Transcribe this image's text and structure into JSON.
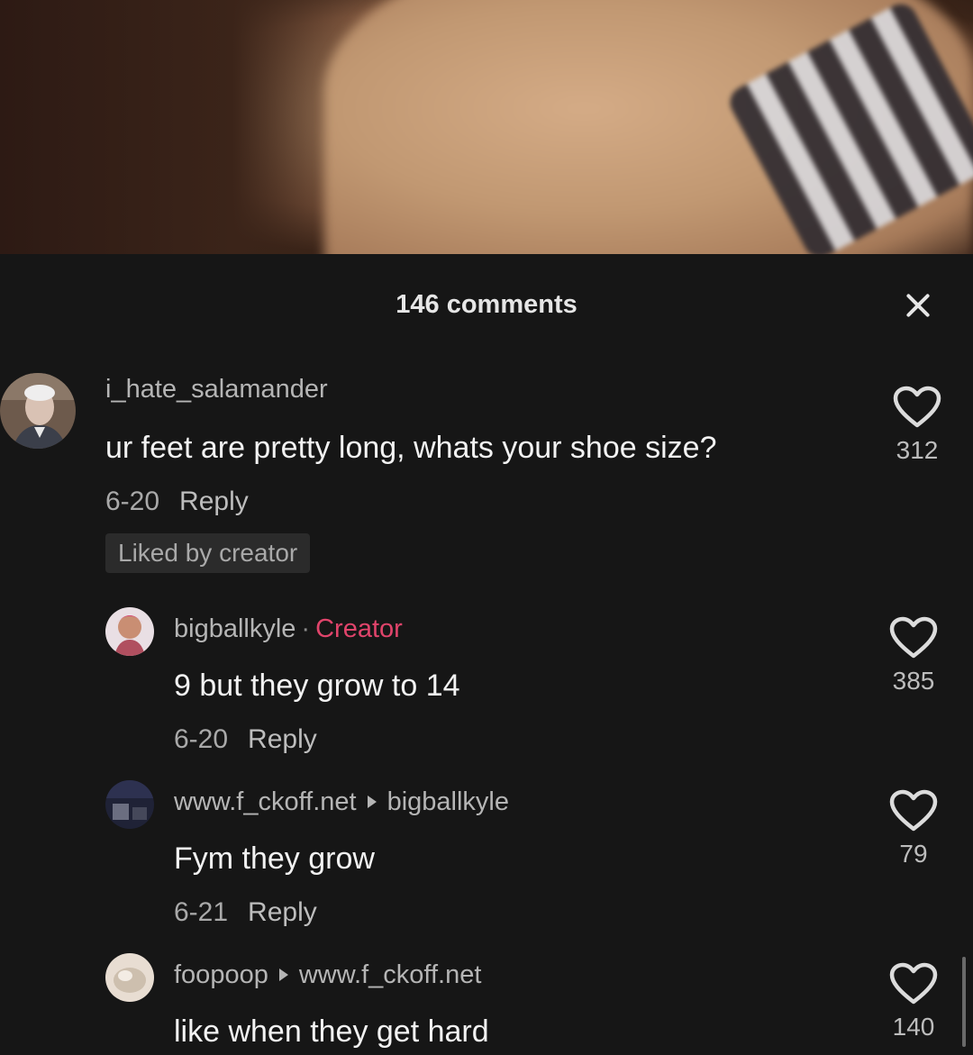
{
  "header": {
    "comments_count": "146 comments"
  },
  "comments": [
    {
      "username": "i_hate_salamander",
      "text": "ur feet are pretty long, whats your shoe size?",
      "date": "6-20",
      "reply_label": "Reply",
      "liked_badge": "Liked by creator",
      "likes": "312"
    },
    {
      "username": "bigballkyle",
      "separator": "·",
      "creator_tag": "Creator",
      "text": "9 but they grow to 14",
      "date": "6-20",
      "reply_label": "Reply",
      "likes": "385"
    },
    {
      "username": "www.f_ckoff.net",
      "reply_to": "bigballkyle",
      "text": "Fym they grow",
      "date": "6-21",
      "reply_label": "Reply",
      "likes": "79"
    },
    {
      "username": "foopoop",
      "reply_to": "www.f_ckoff.net",
      "text": "like when they get hard",
      "likes": "140"
    }
  ],
  "icons": {
    "close": "close-icon",
    "like": "heart-icon",
    "reply_arrow": "triangle-right-icon"
  },
  "colors": {
    "background": "#161616",
    "creator_accent": "#e0446b",
    "badge_bg": "#2b2b2b"
  }
}
